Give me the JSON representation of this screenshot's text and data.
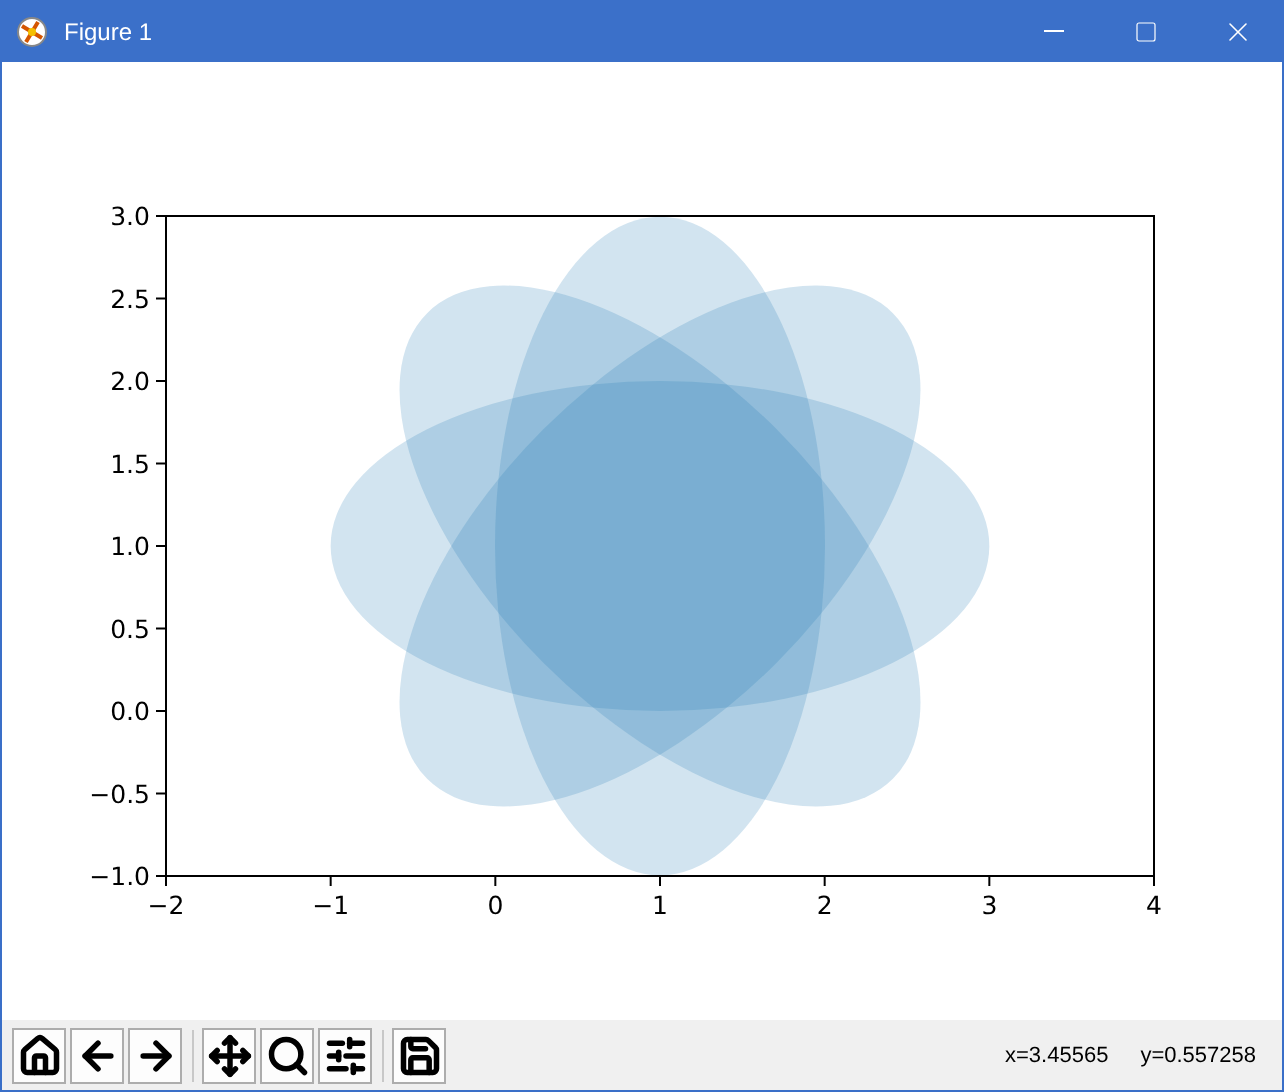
{
  "window": {
    "title": "Figure 1"
  },
  "axes": {
    "xticks": [
      "−2",
      "−1",
      "0",
      "1",
      "2",
      "3",
      "4"
    ],
    "yticks": [
      "3.0",
      "2.5",
      "2.0",
      "1.5",
      "1.0",
      "0.5",
      "0.0",
      "−0.5",
      "−1.0"
    ]
  },
  "toolbar": {
    "button_groups": [
      {
        "buttons": [
          {
            "kind": "home"
          },
          {
            "kind": "back"
          },
          {
            "kind": "forward"
          }
        ]
      },
      {
        "buttons": [
          {
            "kind": "pan"
          },
          {
            "kind": "zoom"
          },
          {
            "kind": "configure"
          }
        ]
      },
      {
        "buttons": [
          {
            "kind": "save"
          }
        ]
      }
    ],
    "coordinates": [
      "x=3.45565",
      "y=0.557258"
    ]
  }
}
